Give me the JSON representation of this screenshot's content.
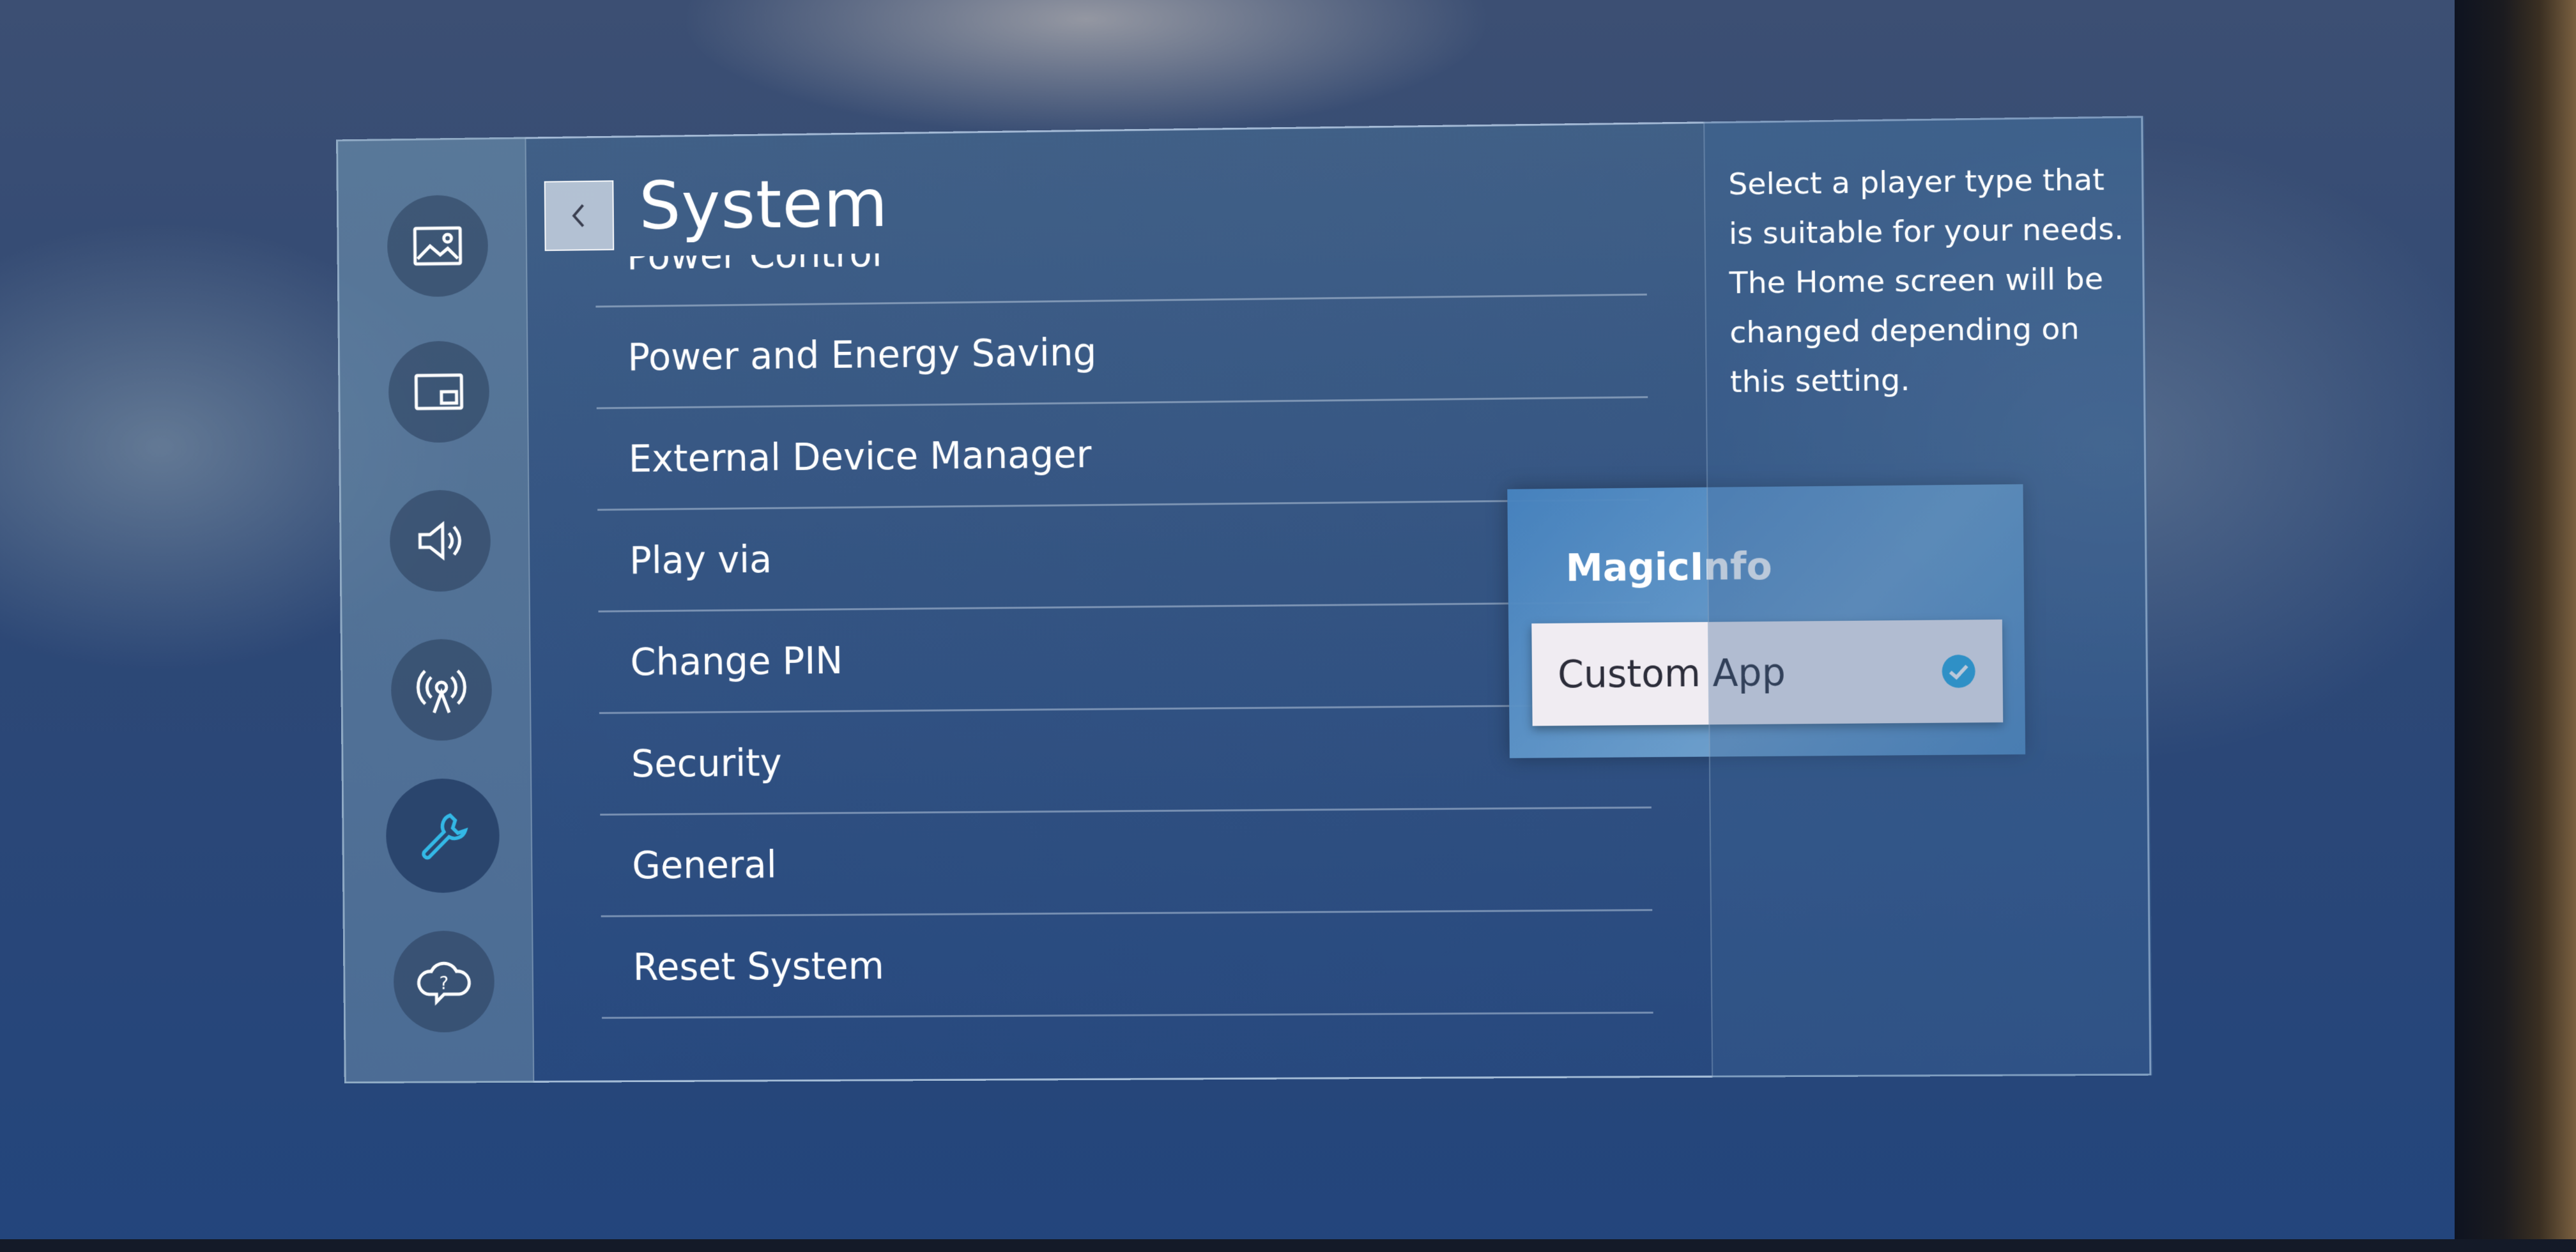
{
  "header": {
    "title": "System"
  },
  "sidebar": {
    "items": [
      {
        "icon": "picture-icon"
      },
      {
        "icon": "screen-icon"
      },
      {
        "icon": "sound-icon"
      },
      {
        "icon": "network-icon"
      },
      {
        "icon": "wrench-icon",
        "active": true
      },
      {
        "icon": "support-icon"
      }
    ]
  },
  "menu": {
    "items": [
      {
        "label": "Power Control"
      },
      {
        "label": "Power and Energy Saving"
      },
      {
        "label": "External Device Manager"
      },
      {
        "label": "Play via"
      },
      {
        "label": "Change PIN"
      },
      {
        "label": "Security"
      },
      {
        "label": "General"
      },
      {
        "label": "Reset System"
      }
    ]
  },
  "popup": {
    "options": [
      {
        "label": "MagicInfo",
        "selected": false
      },
      {
        "label": "Custom App",
        "selected": true
      }
    ]
  },
  "help": {
    "text": "Select a player type that is suitable for your needs. The Home screen will be changed depending on this setting."
  },
  "colors": {
    "accent_check": "#29a8e0",
    "selected_bg": "#f0ecf2",
    "popup_bg": "#5a96cc"
  }
}
